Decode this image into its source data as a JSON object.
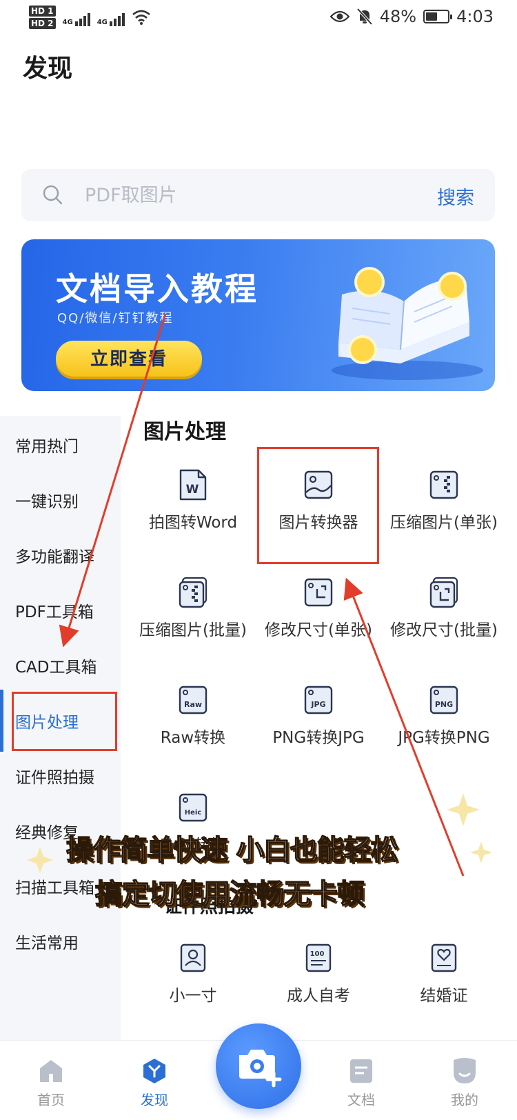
{
  "status_bar": {
    "hd1": "HD 1",
    "hd2": "HD 2",
    "net1": "4G",
    "net2": "4G",
    "battery": "48%",
    "time": "4:03"
  },
  "page": {
    "title": "发现"
  },
  "search": {
    "placeholder": "PDF取图片",
    "button": "搜索"
  },
  "banner": {
    "title": "文档导入教程",
    "subtitle": "QQ/微信/钉钉教程",
    "button": "立即查看"
  },
  "sidebar": {
    "items": [
      {
        "label": "常用热门"
      },
      {
        "label": "一键识别"
      },
      {
        "label": "多功能翻译"
      },
      {
        "label": "PDF工具箱"
      },
      {
        "label": "CAD工具箱"
      },
      {
        "label": "图片处理"
      },
      {
        "label": "证件照拍摄"
      },
      {
        "label": "经典修复"
      },
      {
        "label": "扫描工具箱"
      },
      {
        "label": "生活常用"
      }
    ],
    "active_index": 5
  },
  "image_section": {
    "title": "图片处理",
    "tools": [
      {
        "label": "拍图转Word",
        "icon": "word-doc-icon"
      },
      {
        "label": "图片转换器",
        "icon": "image-icon"
      },
      {
        "label": "压缩图片(单张)",
        "icon": "compress-icon"
      },
      {
        "label": "压缩图片(批量)",
        "icon": "compress-batch-icon"
      },
      {
        "label": "修改尺寸(单张)",
        "icon": "resize-icon"
      },
      {
        "label": "修改尺寸(批量)",
        "icon": "resize-batch-icon"
      },
      {
        "label": "Raw转换",
        "icon": "raw-file-icon",
        "badge": "Raw"
      },
      {
        "label": "PNG转换JPG",
        "icon": "jpg-file-icon",
        "badge": "JPG"
      },
      {
        "label": "JPG转换PNG",
        "icon": "png-file-icon",
        "badge": "PNG"
      },
      {
        "label": "Heic转换",
        "icon": "heic-file-icon",
        "badge": "Heic"
      }
    ]
  },
  "id_section": {
    "title": "证件照拍摄",
    "tools": [
      {
        "label": "小一寸",
        "icon": "id-photo-icon"
      },
      {
        "label": "成人自考",
        "icon": "exam-icon",
        "badge": "100"
      },
      {
        "label": "结婚证",
        "icon": "marriage-cert-icon"
      }
    ]
  },
  "overlay_caption": {
    "line1": "操作简单快速 小白也能轻松",
    "line2": "搞定切使用流畅无卡顿"
  },
  "bottom_nav": {
    "tabs": [
      {
        "label": "首页",
        "icon": "home-icon"
      },
      {
        "label": "发现",
        "icon": "discover-icon"
      },
      {
        "label": "文档",
        "icon": "document-icon"
      },
      {
        "label": "我的",
        "icon": "profile-icon"
      }
    ],
    "active_index": 1,
    "camera_icon": "camera-plus-icon"
  },
  "colors": {
    "accent": "#2c6fd4",
    "annotation_red": "#e23d2b",
    "banner_blue": "#2566e8",
    "banner_button": "#f7c21b"
  }
}
